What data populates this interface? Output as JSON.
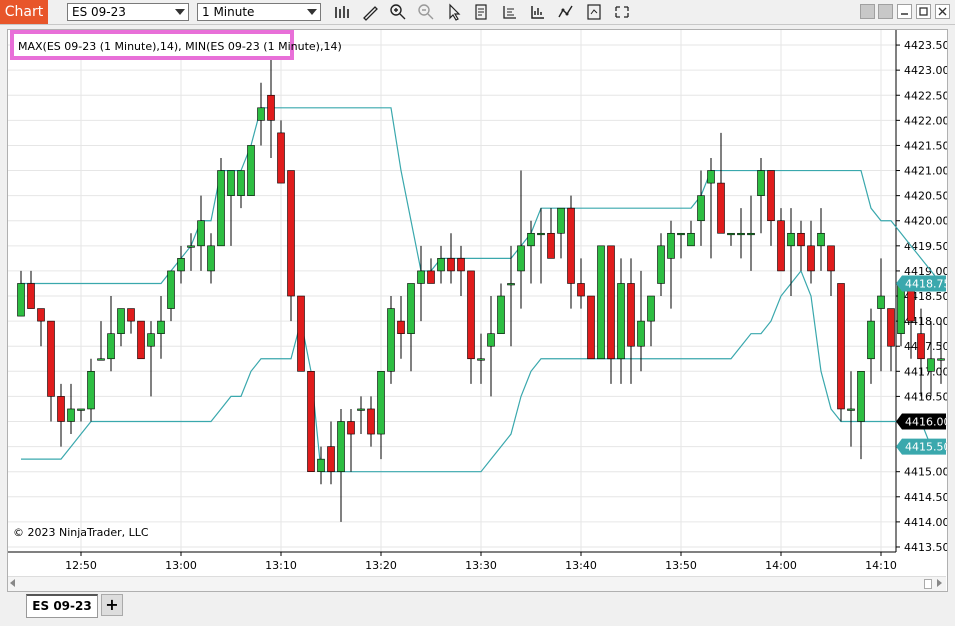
{
  "window": {
    "title": "Chart",
    "instrument": "ES 09-23",
    "interval": "1 Minute",
    "accent_color": "#e8562a",
    "icons": [
      "bar-type-icon",
      "draw-tool-icon",
      "zoom-in-icon",
      "zoom-out-icon",
      "pointer-icon",
      "data-box-icon",
      "chart-properties-icon",
      "indicators-icon",
      "strategies-icon",
      "templates-icon",
      "snapshot-icon"
    ],
    "window_buttons": [
      "minimize-icon",
      "restore-icon",
      "maximize-icon",
      "close-icon"
    ]
  },
  "chart": {
    "indicator_label": "MAX(ES 09-23 (1 Minute),14), MIN(ES 09-23 (1 Minute),14)",
    "copyright": "© 2023 NinjaTrader, LLC",
    "colors": {
      "up": "#2dbe42",
      "down": "#e01c1c",
      "indicator": "#3aa8ad",
      "current_price_bg": "#000000"
    },
    "price_badges": [
      {
        "value": "4418.75",
        "kind": "max"
      },
      {
        "value": "4416.00",
        "kind": "last"
      },
      {
        "value": "4415.50",
        "kind": "min"
      }
    ]
  },
  "chart_data": {
    "type": "candlestick",
    "y_ticks": [
      "4413.50",
      "4414.00",
      "4414.50",
      "4415.00",
      "4415.50",
      "4416.00",
      "4416.50",
      "4417.00",
      "4417.50",
      "4418.00",
      "4418.50",
      "4419.00",
      "4419.50",
      "4420.00",
      "4420.50",
      "4421.00",
      "4421.50",
      "4422.00",
      "4422.50",
      "4423.00",
      "4423.50"
    ],
    "ylim": [
      4413.4,
      4423.8
    ],
    "x_ticks": [
      "12:50",
      "13:00",
      "13:10",
      "13:20",
      "13:30",
      "13:40",
      "13:50",
      "14:00",
      "14:10"
    ],
    "series": [
      {
        "name": "ES 09-23 (1 Minute)",
        "ohlc": [
          [
            4418.1,
            4419.0,
            4418.1,
            4418.75
          ],
          [
            4418.75,
            4419.0,
            4418.25,
            4418.25
          ],
          [
            4418.25,
            4418.25,
            4417.5,
            4418.0
          ],
          [
            4418.0,
            4418.0,
            4416.0,
            4416.5
          ],
          [
            4416.5,
            4416.75,
            4415.5,
            4416.0
          ],
          [
            4416.0,
            4416.75,
            4415.75,
            4416.25
          ],
          [
            4416.25,
            4416.25,
            4416.0,
            4416.25
          ],
          [
            4416.25,
            4417.25,
            4416.0,
            4417.0
          ],
          [
            4417.25,
            4418.0,
            4417.25,
            4417.25
          ],
          [
            4417.25,
            4418.5,
            4417.0,
            4417.75
          ],
          [
            4417.75,
            4418.25,
            4417.5,
            4418.25
          ],
          [
            4418.25,
            4418.25,
            4417.75,
            4418.0
          ],
          [
            4418.0,
            4418.0,
            4417.75,
            4417.25
          ],
          [
            4417.5,
            4418.0,
            4416.5,
            4417.75
          ],
          [
            4417.75,
            4418.5,
            4417.25,
            4418.0
          ],
          [
            4418.25,
            4419.0,
            4418.0,
            4419.0
          ],
          [
            4419.0,
            4419.5,
            4418.75,
            4419.25
          ],
          [
            4419.5,
            4419.75,
            4419.0,
            4419.5
          ],
          [
            4419.5,
            4420.5,
            4419.0,
            4420.0
          ],
          [
            4419.0,
            4419.75,
            4418.75,
            4419.5
          ],
          [
            4419.5,
            4421.25,
            4419.5,
            4421.0
          ],
          [
            4420.5,
            4421.0,
            4419.5,
            4421.0
          ],
          [
            4420.5,
            4420.75,
            4420.25,
            4421.0
          ],
          [
            4420.5,
            4421.25,
            4420.5,
            4421.5
          ],
          [
            4422.0,
            4422.75,
            4421.5,
            4422.25
          ],
          [
            4422.5,
            4423.25,
            4421.25,
            4422.0
          ],
          [
            4421.75,
            4422.0,
            4420.75,
            4420.75
          ],
          [
            4421.0,
            4421.0,
            4418.0,
            4418.5
          ],
          [
            4418.5,
            4418.5,
            4417.0,
            4417.0
          ],
          [
            4417.0,
            4417.0,
            4415.0,
            4415.0
          ],
          [
            4415.0,
            4415.5,
            4414.75,
            4415.25
          ],
          [
            4415.5,
            4416.0,
            4414.75,
            4415.0
          ],
          [
            4415.0,
            4416.25,
            4414.0,
            4416.0
          ],
          [
            4416.0,
            4416.25,
            4415.0,
            4415.75
          ],
          [
            4416.25,
            4416.5,
            4415.75,
            4416.25
          ],
          [
            4416.25,
            4416.5,
            4415.5,
            4415.75
          ],
          [
            4415.75,
            4417.0,
            4415.25,
            4417.0
          ],
          [
            4417.0,
            4418.5,
            4416.75,
            4418.25
          ],
          [
            4418.0,
            4418.5,
            4417.25,
            4417.75
          ],
          [
            4417.75,
            4418.75,
            4417.0,
            4418.75
          ],
          [
            4418.75,
            4419.5,
            4418.0,
            4419.0
          ],
          [
            4419.0,
            4419.25,
            4418.75,
            4418.75
          ],
          [
            4419.0,
            4419.5,
            4418.75,
            4419.25
          ],
          [
            4419.25,
            4419.75,
            4418.75,
            4419.0
          ],
          [
            4419.25,
            4419.5,
            4418.5,
            4419.0
          ],
          [
            4419.0,
            4419.0,
            4416.75,
            4417.25
          ],
          [
            4417.25,
            4417.75,
            4416.75,
            4417.25
          ],
          [
            4417.5,
            4418.5,
            4416.5,
            4417.75
          ],
          [
            4417.75,
            4418.75,
            4417.75,
            4418.5
          ],
          [
            4418.75,
            4419.5,
            4417.5,
            4418.75
          ],
          [
            4419.0,
            4421.0,
            4418.25,
            4419.5
          ],
          [
            4419.5,
            4420.0,
            4418.75,
            4419.75
          ],
          [
            4419.75,
            4420.25,
            4418.75,
            4419.75
          ],
          [
            4419.75,
            4420.25,
            4419.25,
            4419.25
          ],
          [
            4419.75,
            4420.25,
            4419.25,
            4420.25
          ],
          [
            4420.25,
            4420.5,
            4418.25,
            4418.75
          ],
          [
            4418.75,
            4419.25,
            4418.25,
            4418.5
          ],
          [
            4418.5,
            4418.5,
            4417.5,
            4417.25
          ],
          [
            4417.25,
            4419.5,
            4417.25,
            4419.5
          ],
          [
            4419.5,
            4419.5,
            4416.75,
            4417.25
          ],
          [
            4417.25,
            4419.25,
            4416.75,
            4418.75
          ],
          [
            4418.75,
            4419.25,
            4416.75,
            4417.5
          ],
          [
            4417.5,
            4419.0,
            4417.0,
            4418.0
          ],
          [
            4418.0,
            4418.5,
            4417.5,
            4418.5
          ],
          [
            4418.75,
            4419.75,
            4418.5,
            4419.5
          ],
          [
            4419.25,
            4420.0,
            4418.25,
            4419.75
          ],
          [
            4419.75,
            4419.75,
            4419.25,
            4419.75
          ],
          [
            4419.5,
            4420.0,
            4419.5,
            4419.75
          ],
          [
            4420.0,
            4421.0,
            4419.5,
            4420.5
          ],
          [
            4420.75,
            4421.25,
            4419.25,
            4421.0
          ],
          [
            4420.75,
            4421.75,
            4419.75,
            4419.75
          ],
          [
            4419.75,
            4419.75,
            4419.5,
            4419.75
          ],
          [
            4419.75,
            4420.25,
            4419.25,
            4419.75
          ],
          [
            4419.75,
            4420.5,
            4419.0,
            4419.75
          ],
          [
            4420.5,
            4421.25,
            4419.75,
            4421.0
          ],
          [
            4421.0,
            4421.0,
            4419.5,
            4420.0
          ],
          [
            4420.0,
            4420.25,
            4419.0,
            4419.0
          ],
          [
            4419.5,
            4420.25,
            4418.5,
            4419.75
          ],
          [
            4419.75,
            4420.0,
            4419.0,
            4419.5
          ],
          [
            4419.5,
            4420.0,
            4418.75,
            4419.0
          ],
          [
            4419.5,
            4420.25,
            4419.0,
            4419.75
          ],
          [
            4419.5,
            4419.5,
            4418.5,
            4419.0
          ],
          [
            4418.75,
            4418.75,
            4416.0,
            4416.25
          ],
          [
            4416.25,
            4417.0,
            4415.5,
            4416.25
          ],
          [
            4416.0,
            4417.0,
            4415.25,
            4417.0
          ],
          [
            4417.25,
            4418.25,
            4416.75,
            4418.0
          ],
          [
            4418.25,
            4419.25,
            4417.0,
            4418.5
          ],
          [
            4418.25,
            4418.25,
            4417.0,
            4417.5
          ],
          [
            4417.75,
            4418.5,
            4417.5,
            4418.75
          ],
          [
            4418.75,
            4418.75,
            4417.25,
            4418.0
          ],
          [
            4417.75,
            4418.25,
            4416.5,
            4417.25
          ],
          [
            4417.0,
            4418.0,
            4416.5,
            4417.25
          ],
          [
            4417.25,
            4418.0,
            4416.75,
            4417.25
          ],
          [
            4417.25,
            4418.0,
            4416.25,
            4417.5
          ],
          [
            4417.5,
            4418.0,
            4415.5,
            4415.5
          ],
          [
            4415.5,
            4416.5,
            4415.0,
            4415.75
          ],
          [
            4416.0,
            4416.0,
            4415.75,
            4416.0
          ]
        ]
      },
      {
        "name": "MAX(14)",
        "values": [
          4418.75,
          4418.75,
          4418.75,
          4418.75,
          4418.75,
          4418.75,
          4418.75,
          4418.75,
          4418.75,
          4418.75,
          4418.75,
          4418.75,
          4418.75,
          4418.75,
          4418.75,
          4419.0,
          4419.25,
          4419.5,
          4420.0,
          4420.0,
          4421.0,
          4421.0,
          4421.0,
          4421.5,
          4422.25,
          4422.25,
          4422.25,
          4422.25,
          4422.25,
          4422.25,
          4422.25,
          4422.25,
          4422.25,
          4422.25,
          4422.25,
          4422.25,
          4422.25,
          4422.25,
          4421.0,
          4420.0,
          4419.0,
          4419.0,
          4419.25,
          4419.25,
          4419.25,
          4419.25,
          4419.25,
          4419.25,
          4419.25,
          4419.25,
          4419.5,
          4419.75,
          4420.25,
          4420.25,
          4420.25,
          4420.25,
          4420.25,
          4420.25,
          4420.25,
          4420.25,
          4420.25,
          4420.25,
          4420.25,
          4420.25,
          4420.25,
          4420.25,
          4420.25,
          4420.25,
          4420.5,
          4421.0,
          4421.0,
          4421.0,
          4421.0,
          4421.0,
          4421.0,
          4421.0,
          4421.0,
          4421.0,
          4421.0,
          4421.0,
          4421.0,
          4421.0,
          4421.0,
          4421.0,
          4421.0,
          4420.25,
          4420.0,
          4420.0,
          4419.75,
          4419.5,
          4419.25,
          4419.0,
          4418.75
        ]
      },
      {
        "name": "MIN(14)",
        "values": [
          4415.25,
          4415.25,
          4415.25,
          4415.25,
          4415.25,
          4415.5,
          4415.75,
          4416.0,
          4416.0,
          4416.0,
          4416.0,
          4416.0,
          4416.0,
          4416.0,
          4416.0,
          4416.0,
          4416.0,
          4416.0,
          4416.0,
          4416.0,
          4416.25,
          4416.5,
          4416.5,
          4417.0,
          4417.25,
          4417.25,
          4417.25,
          4417.25,
          4418.0,
          4417.0,
          4415.0,
          4415.0,
          4415.0,
          4415.0,
          4415.0,
          4415.0,
          4415.0,
          4415.0,
          4415.0,
          4415.0,
          4415.0,
          4415.0,
          4415.0,
          4415.0,
          4415.0,
          4415.0,
          4415.0,
          4415.25,
          4415.5,
          4415.75,
          4416.5,
          4417.0,
          4417.25,
          4417.25,
          4417.25,
          4417.25,
          4417.25,
          4417.25,
          4417.25,
          4417.25,
          4417.25,
          4417.25,
          4417.25,
          4417.25,
          4417.25,
          4417.25,
          4417.25,
          4417.25,
          4417.25,
          4417.25,
          4417.25,
          4417.25,
          4417.5,
          4417.75,
          4417.75,
          4418.0,
          4418.5,
          4418.75,
          4419.0,
          4418.5,
          4417.0,
          4416.25,
          4416.0,
          4416.0,
          4416.0,
          4416.0,
          4416.0,
          4416.0,
          4416.0,
          4416.0,
          4416.0,
          4415.5,
          4415.5
        ]
      }
    ],
    "grid": true,
    "legend": "top-left"
  },
  "tabs": {
    "active": "ES 09-23",
    "add_label": "+"
  }
}
